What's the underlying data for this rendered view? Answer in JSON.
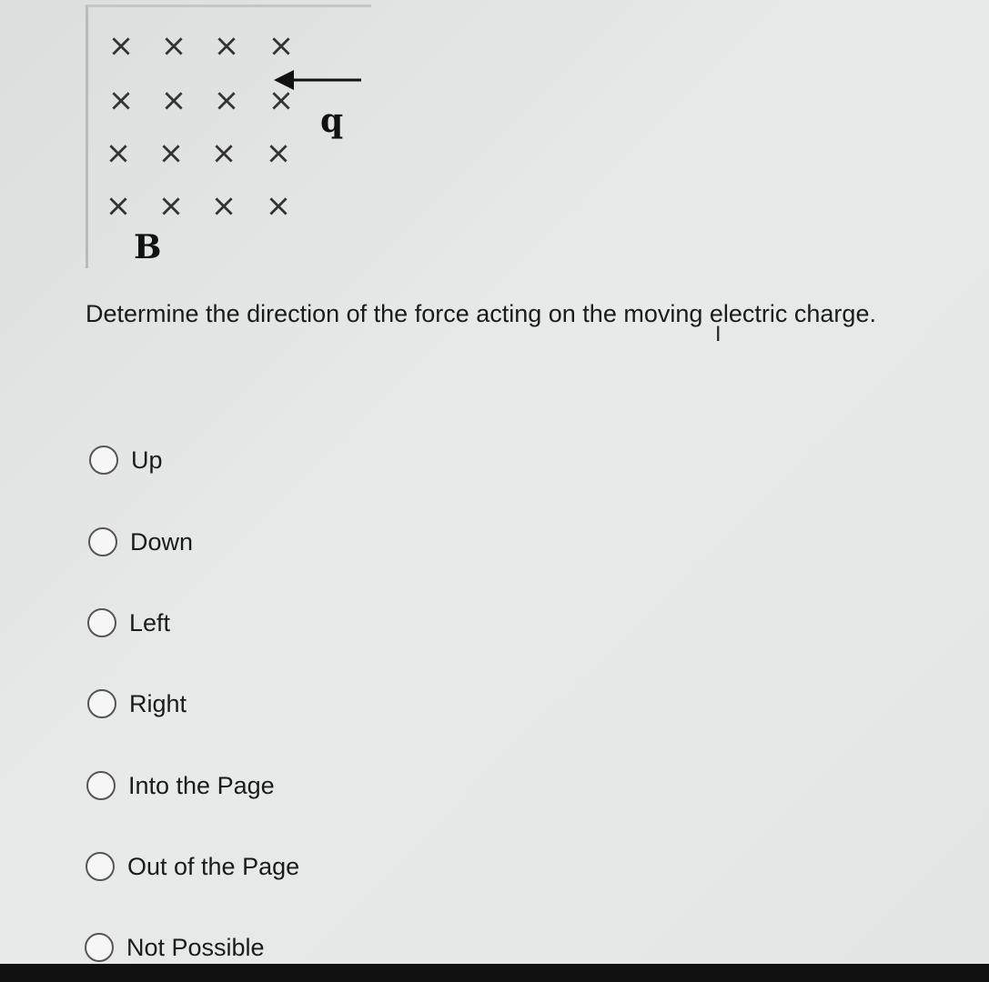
{
  "figure": {
    "field_symbol": "×",
    "field_label": "B",
    "charge_label": "q",
    "field_direction": "into-page",
    "velocity_direction": "left"
  },
  "question": "Determine the direction of the force acting on the moving electric charge.",
  "options": [
    {
      "label": "Up",
      "selected": false
    },
    {
      "label": "Down",
      "selected": false
    },
    {
      "label": "Left",
      "selected": false
    },
    {
      "label": "Right",
      "selected": false
    },
    {
      "label": "Into the Page",
      "selected": false
    },
    {
      "label": "Out of the Page",
      "selected": false
    },
    {
      "label": "Not Possible",
      "selected": false
    }
  ]
}
